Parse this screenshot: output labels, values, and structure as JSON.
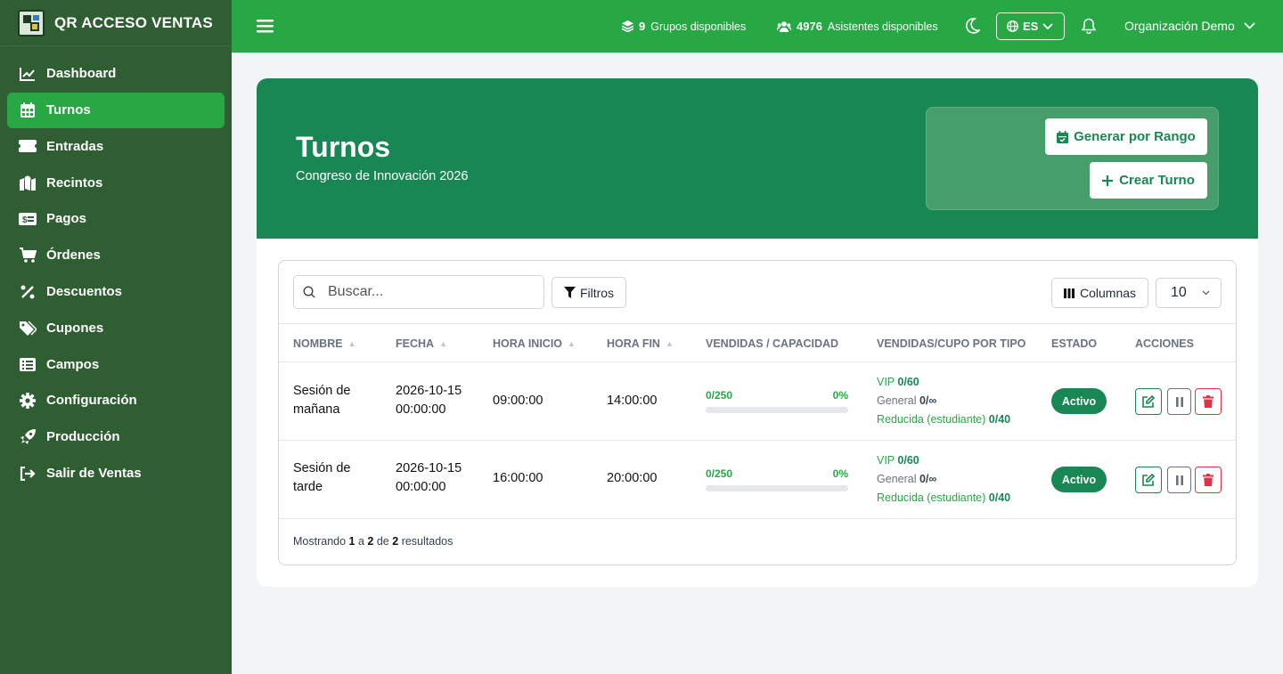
{
  "app": {
    "title": "QR ACCESO VENTAS"
  },
  "sidebar": {
    "items": [
      {
        "label": "Dashboard",
        "icon": "chart-line-icon"
      },
      {
        "label": "Turnos",
        "icon": "calendar-icon",
        "active": true
      },
      {
        "label": "Entradas",
        "icon": "ticket-icon"
      },
      {
        "label": "Recintos",
        "icon": "map-pin-icon"
      },
      {
        "label": "Pagos",
        "icon": "money-bill-icon"
      },
      {
        "label": "Órdenes",
        "icon": "cart-icon"
      },
      {
        "label": "Descuentos",
        "icon": "percent-icon"
      },
      {
        "label": "Cupones",
        "icon": "tags-icon"
      },
      {
        "label": "Campos",
        "icon": "list-icon"
      },
      {
        "label": "Configuración",
        "icon": "gear-icon"
      },
      {
        "label": "Producción",
        "icon": "rocket-icon"
      },
      {
        "label": "Salir de Ventas",
        "icon": "sign-out-icon"
      }
    ]
  },
  "topbar": {
    "groups_count": "9",
    "groups_label": "Grupos disponibles",
    "attendees_count": "4976",
    "attendees_label": "Asistentes disponibles",
    "language": "ES",
    "organization": "Organización Demo"
  },
  "page": {
    "title": "Turnos",
    "subtitle": "Congreso de Innovación 2026",
    "generate_button": "Generar por Rango",
    "create_button": "Crear Turno"
  },
  "toolbar": {
    "search_placeholder": "Buscar...",
    "filters_label": "Filtros",
    "columns_label": "Columnas",
    "per_page": "10"
  },
  "table": {
    "headers": [
      "NOMBRE",
      "FECHA",
      "HORA INICIO",
      "HORA FIN",
      "VENDIDAS / CAPACIDAD",
      "VENDIDAS/CUPO POR TIPO",
      "ESTADO",
      "ACCIONES"
    ],
    "rows": [
      {
        "name_line1": "Sesión de",
        "name_line2": "mañana",
        "date_line1": "2026-10-15",
        "date_line2": "00:00:00",
        "start": "09:00:00",
        "end": "14:00:00",
        "sold": "0/250",
        "percent": "0%",
        "fill": 0,
        "types": [
          {
            "name": "VIP",
            "value": "0/60"
          },
          {
            "name": "General",
            "value": "0/∞"
          },
          {
            "name": "Reducida (estudiante)",
            "value": "0/40"
          }
        ],
        "status": "Activo"
      },
      {
        "name_line1": "Sesión de",
        "name_line2": "tarde",
        "date_line1": "2026-10-15",
        "date_line2": "00:00:00",
        "start": "16:00:00",
        "end": "20:00:00",
        "sold": "0/250",
        "percent": "0%",
        "fill": 0,
        "types": [
          {
            "name": "VIP",
            "value": "0/60"
          },
          {
            "name": "General",
            "value": "0/∞"
          },
          {
            "name": "Reducida (estudiante)",
            "value": "0/40"
          }
        ],
        "status": "Activo"
      }
    ]
  },
  "footer": {
    "prefix": "Mostrando",
    "from": "1",
    "a": "a",
    "to": "2",
    "de": "de",
    "total": "2",
    "suffix": "resultados"
  },
  "colors": {
    "primary": "#28a745",
    "sidebar": "#2e5e32",
    "hero": "#198754",
    "danger": "#dc3545"
  }
}
